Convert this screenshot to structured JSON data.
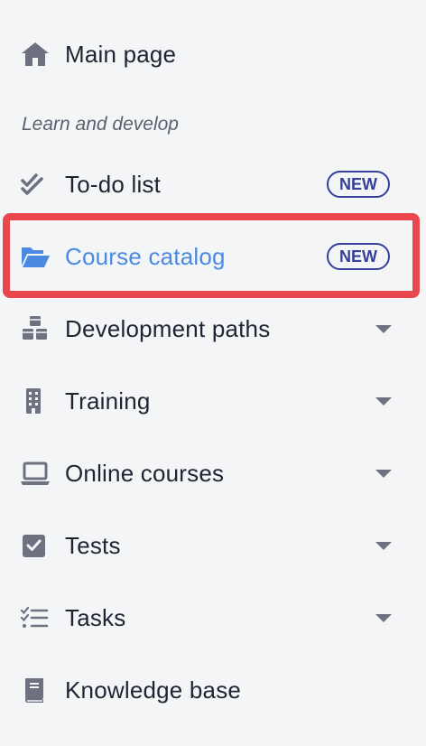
{
  "sidebar": {
    "main_page": {
      "label": "Main page",
      "icon": "home-icon"
    },
    "section_title": "Learn and develop",
    "items": [
      {
        "label": "To-do list",
        "icon": "double-check-icon",
        "badge": "NEW"
      },
      {
        "label": "Course catalog",
        "icon": "folder-open-icon",
        "badge": "NEW",
        "active": true
      },
      {
        "label": "Development paths",
        "icon": "cubes-icon",
        "expandable": true
      },
      {
        "label": "Training",
        "icon": "building-icon",
        "expandable": true
      },
      {
        "label": "Online courses",
        "icon": "laptop-icon",
        "expandable": true
      },
      {
        "label": "Tests",
        "icon": "checkbox-icon",
        "expandable": true
      },
      {
        "label": "Tasks",
        "icon": "checklist-icon",
        "expandable": true
      },
      {
        "label": "Knowledge base",
        "icon": "book-icon"
      }
    ]
  },
  "colors": {
    "background": "#f4f5f7",
    "text": "#1f2433",
    "active": "#4a8ae2",
    "badge": "#36409a",
    "highlight": "#e9474d"
  }
}
